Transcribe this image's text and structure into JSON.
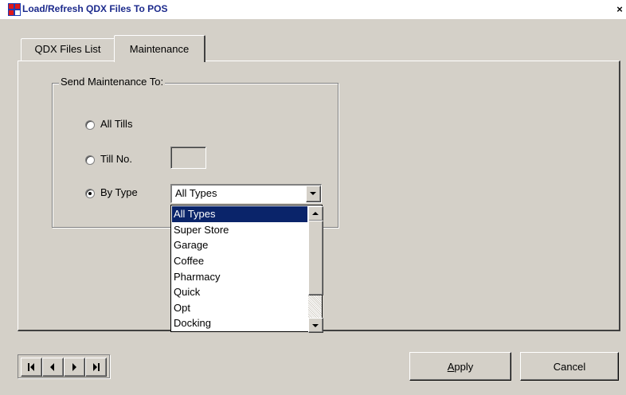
{
  "window": {
    "title": "Load/Refresh QDX Files To POS",
    "close_glyph": "×"
  },
  "tabs": [
    {
      "label": "QDX Files List",
      "active": false
    },
    {
      "label": "Maintenance",
      "active": true
    }
  ],
  "maintenance": {
    "group_label": "Send Maintenance To:",
    "options": [
      {
        "label": "All Tills",
        "selected": false
      },
      {
        "label": "Till No.",
        "selected": false
      },
      {
        "label": "By Type",
        "selected": true
      }
    ],
    "till_no_value": "",
    "type_combo": {
      "value": "All Types",
      "list": [
        "All Types",
        "Super Store",
        "Garage",
        "Coffee",
        "Pharmacy",
        "Quick",
        "Opt",
        "Docking"
      ],
      "highlighted": "All Types"
    }
  },
  "nav": {
    "first": "⏮",
    "prev": "◀",
    "next": "▶",
    "last": "⏭"
  },
  "buttons": {
    "apply": "Apply",
    "cancel": "Cancel"
  },
  "icons": {
    "app": "app-icon",
    "close": "close-icon"
  }
}
